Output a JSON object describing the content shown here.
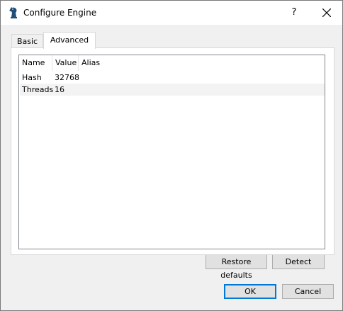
{
  "window": {
    "title": "Configure Engine",
    "help_label": "?"
  },
  "tabs": [
    {
      "label": "Basic",
      "active": false
    },
    {
      "label": "Advanced",
      "active": true
    }
  ],
  "table": {
    "columns": [
      "Name",
      "Value",
      "Alias"
    ],
    "rows": [
      {
        "name": "Hash",
        "value": "32768",
        "alias": ""
      },
      {
        "name": "Threads",
        "value": "16",
        "alias": ""
      }
    ]
  },
  "buttons": {
    "restore_defaults": "Restore defaults",
    "detect": "Detect",
    "ok": "OK",
    "cancel": "Cancel"
  },
  "colors": {
    "accent": "#0078d7",
    "icon": "#1f4e79"
  }
}
